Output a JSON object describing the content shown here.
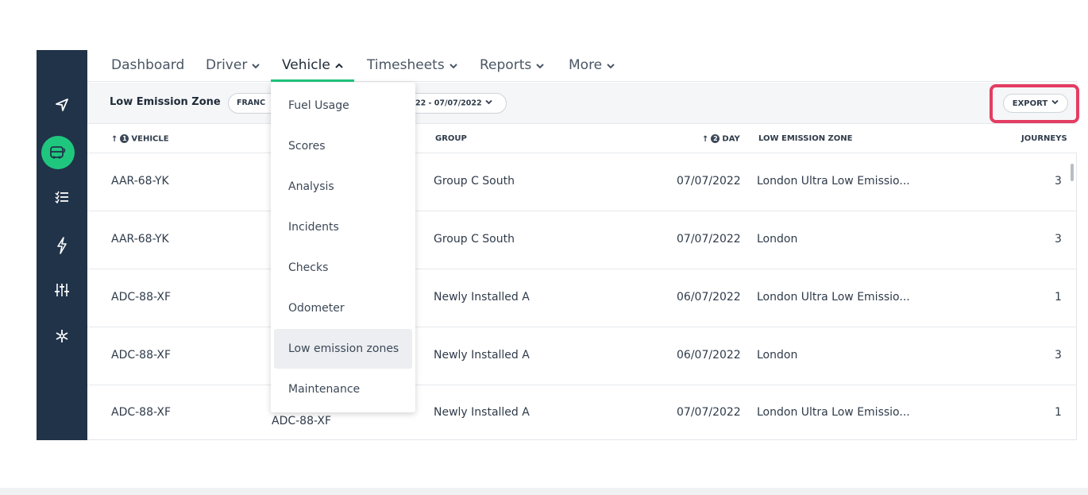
{
  "nav": {
    "items": [
      {
        "label": "Dashboard",
        "has_chevron": false
      },
      {
        "label": "Driver",
        "has_chevron": true
      },
      {
        "label": "Vehicle",
        "has_chevron": true,
        "active": true,
        "open": true
      },
      {
        "label": "Timesheets",
        "has_chevron": true
      },
      {
        "label": "Reports",
        "has_chevron": true
      },
      {
        "label": "More",
        "has_chevron": true
      }
    ]
  },
  "sidebar": {
    "icons": [
      "navigation-arrow-icon",
      "vehicle-icon",
      "checklist-icon",
      "lightning-icon",
      "sliders-icon",
      "snowflake-icon"
    ],
    "active_color": "#1fc77e",
    "background": "#203349"
  },
  "filter": {
    "title": "Low Emission Zone",
    "group_pill": "FRANC",
    "date_pill": "22 - 07/07/2022",
    "export_label": "EXPORT"
  },
  "table": {
    "columns": {
      "vehicle": "VEHICLE",
      "vehicle_sort_order": "1",
      "group": "GROUP",
      "day": "DAY",
      "day_sort_order": "2",
      "zone": "LOW EMISSION ZONE",
      "journeys": "JOURNEYS"
    },
    "rows": [
      {
        "vehicle": "AAR-68-YK",
        "group": "Group C South",
        "day": "07/07/2022",
        "zone": "London Ultra Low Emissio...",
        "journeys": "3"
      },
      {
        "vehicle": "AAR-68-YK",
        "group": "Group C South",
        "day": "07/07/2022",
        "zone": "London",
        "journeys": "3"
      },
      {
        "vehicle": "ADC-88-XF",
        "group": "Newly Installed A",
        "day": "06/07/2022",
        "zone": "London Ultra Low Emissio...",
        "journeys": "1"
      },
      {
        "vehicle": "ADC-88-XF",
        "group": "Newly Installed A",
        "day": "06/07/2022",
        "zone": "London",
        "journeys": "3"
      },
      {
        "vehicle": "ADC-88-XF",
        "partial_name": "ADC-88-XF",
        "group": "Newly Installed A",
        "day": "07/07/2022",
        "zone": "London Ultra Low Emissio...",
        "journeys": "1"
      }
    ]
  },
  "dropdown": {
    "items": [
      "Fuel Usage",
      "Scores",
      "Analysis",
      "Incidents",
      "Checks",
      "Odometer",
      "Low emission zones",
      "Maintenance"
    ],
    "selected_index": 6
  },
  "colors": {
    "accent": "#1fc77e",
    "highlight": "#e43d62",
    "text": "#2f3b4a"
  }
}
